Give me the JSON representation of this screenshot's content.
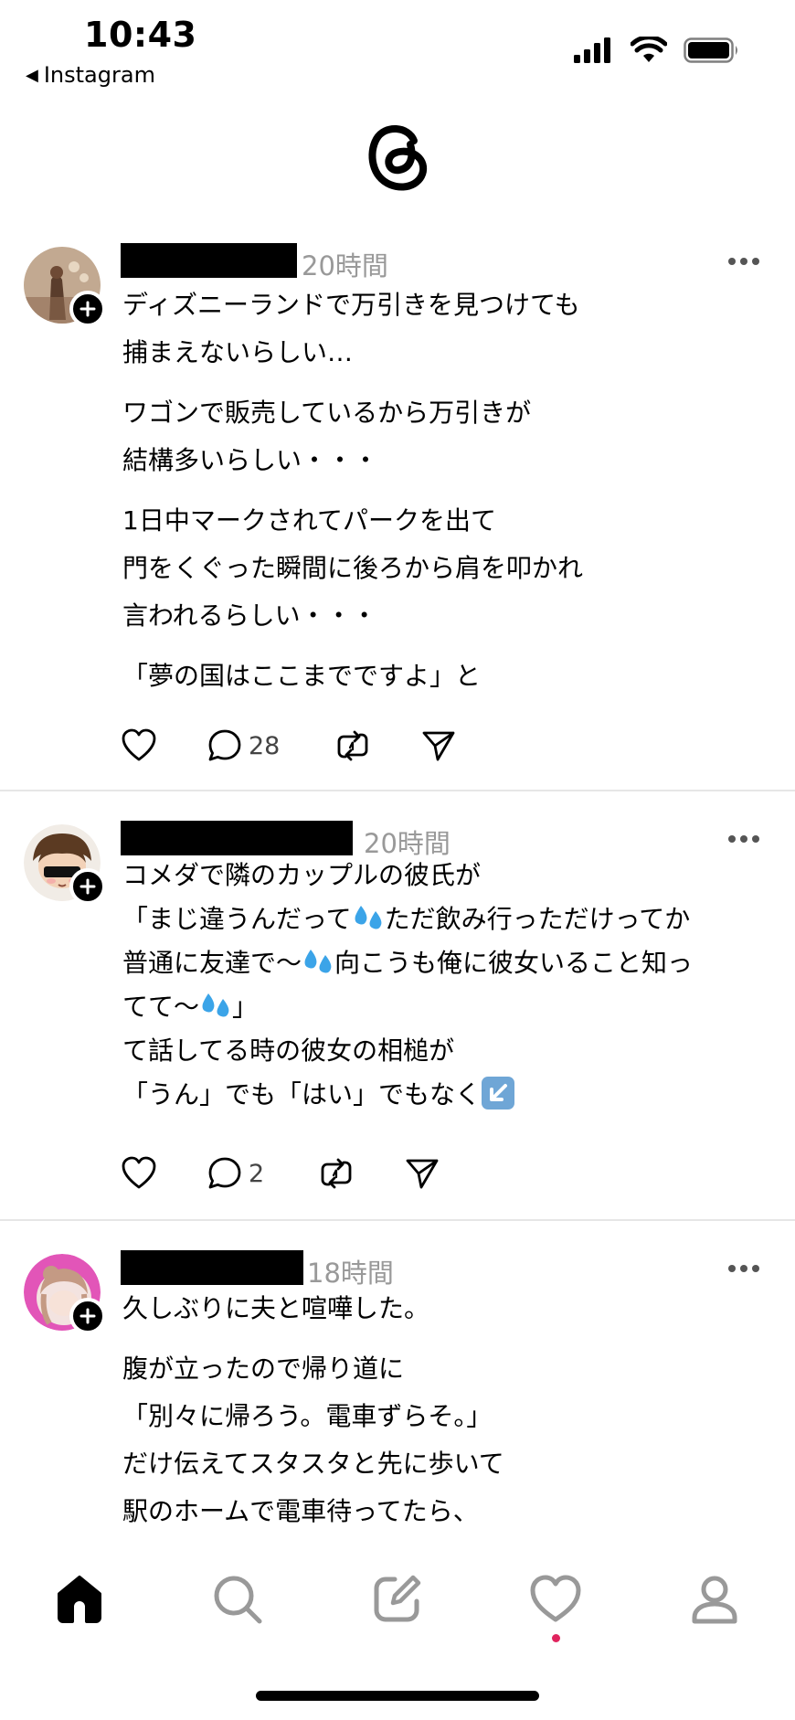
{
  "status_bar": {
    "time": "10:43",
    "back_app": "Instagram",
    "icons": [
      "signal-icon",
      "wifi-icon",
      "battery-icon"
    ]
  },
  "header": {
    "logo": "threads-logo"
  },
  "posts": [
    {
      "time": "20時間",
      "paragraphs": [
        [
          "ディズニーランドで万引きを見つけても",
          "捕まえないらしい…"
        ],
        [
          "ワゴンで販売しているから万引きが",
          "結構多いらしい・・・"
        ],
        [
          "1日中マークされてパークを出て",
          "門をくぐった瞬間に後ろから肩を叩かれ",
          "言われるらしい・・・"
        ],
        [
          "「夢の国はここまでですよ」と"
        ]
      ],
      "reply_count": "28"
    },
    {
      "time": "20時間",
      "lines": {
        "l1": "コメダで隣のカップルの彼氏が",
        "l2a": "「まじ違うんだって",
        "l2b": "ただ飲み行っただけってか",
        "l3a": "普通に友達で〜",
        "l3b": "向こうも俺に彼女いること知っ",
        "l4a": "てて〜",
        "l4b": "」",
        "l5": "て話してる時の彼女の相槌が",
        "l6": "「うん」でも「はい」でもなく"
      },
      "reply_count": "2"
    },
    {
      "time": "18時間",
      "paragraphs": [
        [
          "久しぶりに夫と喧嘩した。"
        ],
        [
          "腹が立ったので帰り道に",
          "「別々に帰ろう。電車ずらそ。」",
          "だけ伝えてスタスタと先に歩いて",
          "駅のホームで電車待ってたら、"
        ]
      ]
    }
  ],
  "bottom_nav": {
    "items": [
      "home-icon",
      "search-icon",
      "compose-icon",
      "activity-icon",
      "profile-icon"
    ],
    "active": "home-icon"
  },
  "colors": {
    "text": "#000000",
    "meta": "#999999",
    "divider": "#e6e6e6",
    "notification_dot": "#e0245e"
  }
}
